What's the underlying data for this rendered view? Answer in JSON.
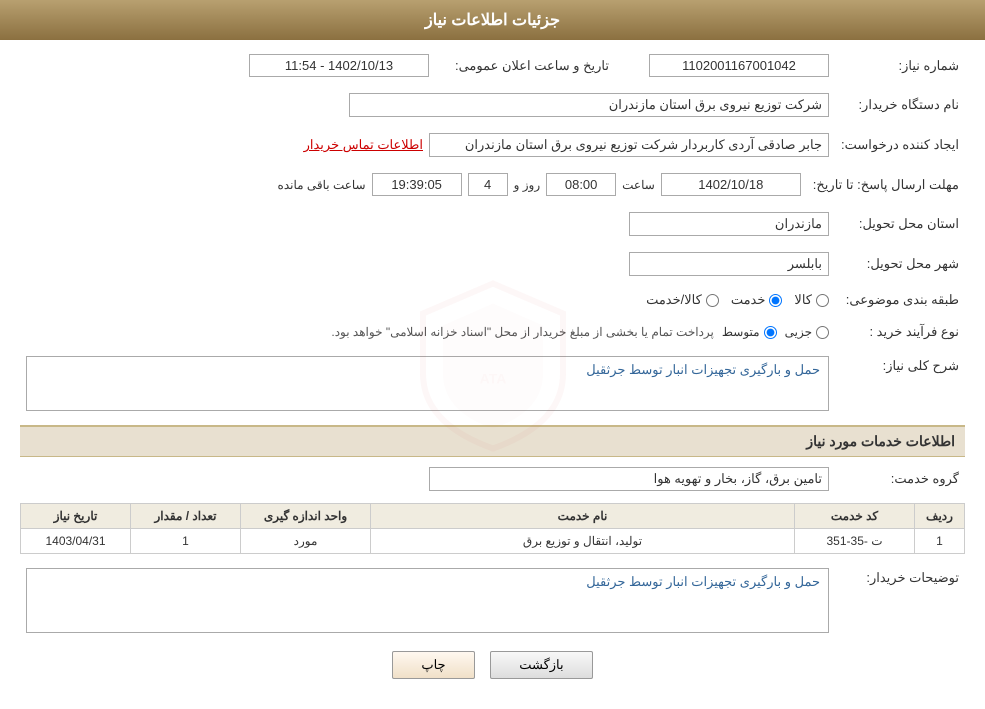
{
  "header": {
    "title": "جزئیات اطلاعات نیاز"
  },
  "fields": {
    "need_number_label": "شماره نیاز:",
    "need_number_value": "1102001167001042",
    "announce_datetime_label": "تاریخ و ساعت اعلان عمومی:",
    "announce_datetime_value": "1402/10/13 - 11:54",
    "buyer_org_label": "نام دستگاه خریدار:",
    "buyer_org_value": "شرکت توزیع نیروی برق استان مازندران",
    "requester_label": "ایجاد کننده درخواست:",
    "requester_value": "جابر صادقی آردی کاربردار شرکت توزیع نیروی برق استان مازندران",
    "contact_link": "اطلاعات تماس خریدار",
    "response_deadline_label": "مهلت ارسال پاسخ: تا تاریخ:",
    "response_date_value": "1402/10/18",
    "response_time_label": "ساعت",
    "response_time_value": "08:00",
    "response_days_label": "روز و",
    "response_days_value": "4",
    "remaining_time_label": "ساعت باقی مانده",
    "remaining_time_value": "19:39:05",
    "delivery_province_label": "استان محل تحویل:",
    "delivery_province_value": "مازندران",
    "delivery_city_label": "شهر محل تحویل:",
    "delivery_city_value": "بابلسر",
    "category_label": "طبقه بندی موضوعی:",
    "category_options": [
      "کالا",
      "خدمت",
      "کالا/خدمت"
    ],
    "category_selected": "خدمت",
    "purchase_type_label": "نوع فرآیند خرید :",
    "purchase_type_options": [
      "جزیی",
      "متوسط"
    ],
    "purchase_type_selected": "متوسط",
    "purchase_type_note": "پرداخت تمام یا بخشی از مبلغ خریدار از محل \"اسناد خزانه اسلامی\" خواهد بود.",
    "general_desc_label": "شرح کلی نیاز:",
    "general_desc_value": "حمل و بارگیری تجهیزات انبار توسط جرثقیل",
    "services_section_label": "اطلاعات خدمات مورد نیاز",
    "service_group_label": "گروه خدمت:",
    "service_group_value": "تامین برق، گاز، بخار و تهویه هوا",
    "table_headers": [
      "ردیف",
      "کد خدمت",
      "نام خدمت",
      "واحد اندازه گیری",
      "تعداد / مقدار",
      "تاریخ نیاز"
    ],
    "table_rows": [
      {
        "row": "1",
        "code": "ت -35-351",
        "name": "تولید، انتقال و توزیع برق",
        "unit": "مورد",
        "quantity": "1",
        "date": "1403/04/31"
      }
    ],
    "buyer_desc_label": "توضیحات خریدار:",
    "buyer_desc_value": "حمل و بارگیری تجهیزات انبار توسط جرثقیل"
  },
  "buttons": {
    "print_label": "چاپ",
    "back_label": "بازگشت"
  }
}
